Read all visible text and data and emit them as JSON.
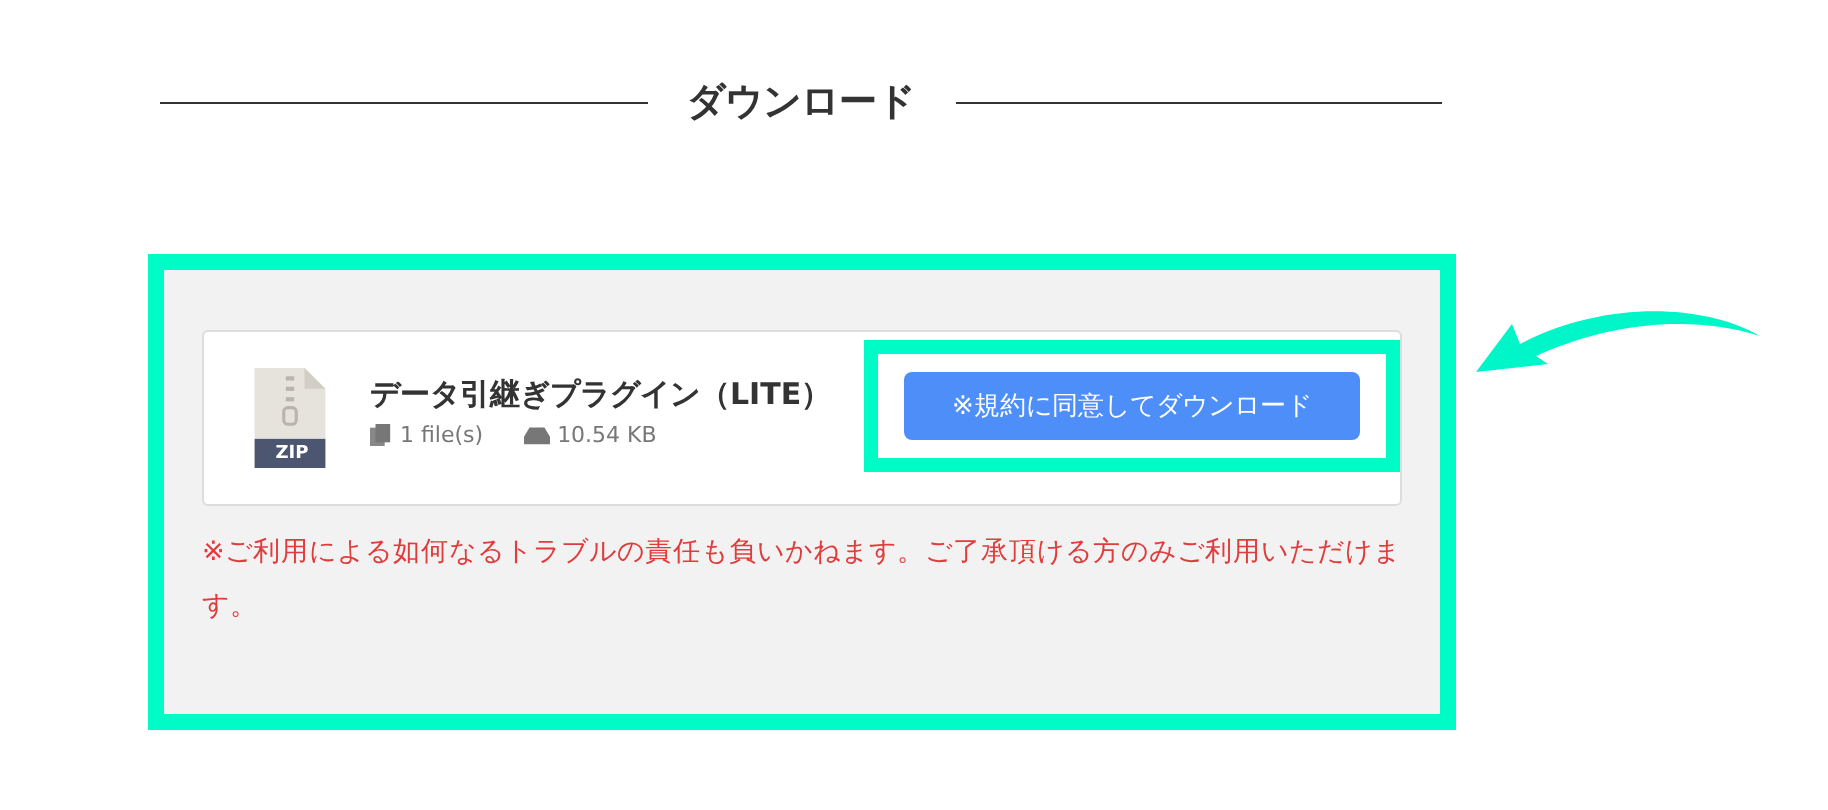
{
  "heading": "ダウンロード",
  "file": {
    "type_label": "ZIP",
    "name": "データ引継ぎプラグイン（LITE）",
    "file_count": "1 file(s)",
    "size": "10.54 KB"
  },
  "download_button": "※規約に同意してダウンロード",
  "notice": "※ご利用による如何なるトラブルの責任も負いかねます。ご了承頂ける方のみご利用いただけます。"
}
